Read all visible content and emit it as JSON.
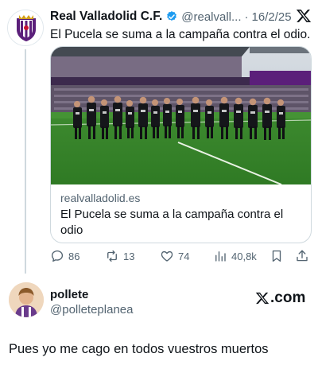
{
  "tweet": {
    "author_name": "Real Valladolid C.F.",
    "author_handle": "@realvall...",
    "date_separator": "·",
    "date": "16/2/25",
    "text": "El Pucela se suma a la campaña contra el odio.",
    "verified_color": "#1d9bf0",
    "icons": [
      "verified-badge-icon",
      "x-logo-icon"
    ],
    "card": {
      "domain": "realvalladolid.es",
      "title": "El Pucela se suma a la campaña contra el odio",
      "image_alt_icon": "team-photo-image"
    },
    "actions": {
      "replies": "86",
      "reposts": "13",
      "likes": "74",
      "views": "40,8k",
      "icons": [
        "reply-icon",
        "repost-icon",
        "like-icon",
        "views-icon",
        "bookmark-icon",
        "share-icon"
      ]
    }
  },
  "quote": {
    "user_name": "pollete",
    "user_handle": "@polleteplanea",
    "watermark": ".com",
    "watermark_icon": "x-logo-icon"
  },
  "reply": {
    "text": "Pues yo me cago en todos vuestros muertos"
  },
  "colors": {
    "text_primary": "#0f1419",
    "text_secondary": "#536471",
    "border": "#cfd9de",
    "club_purple": "#5b1f7a"
  }
}
